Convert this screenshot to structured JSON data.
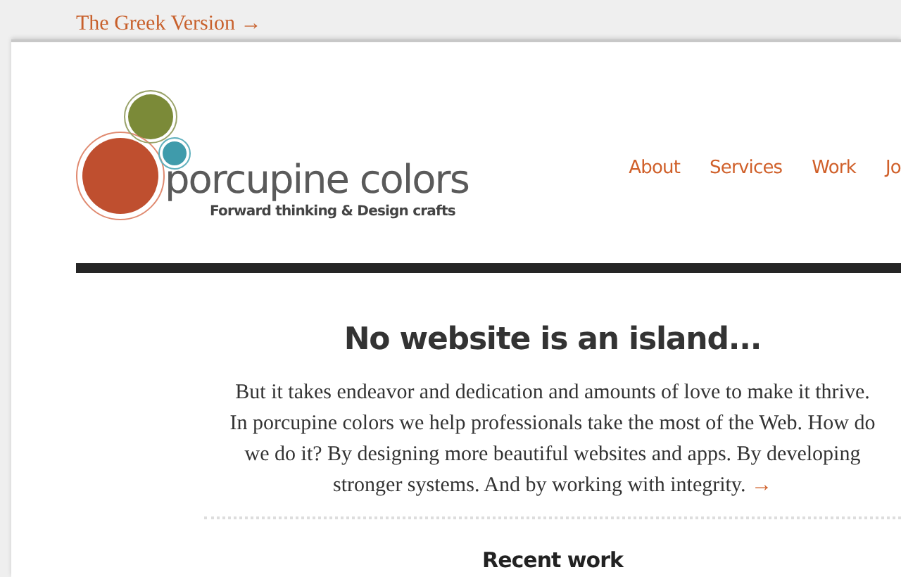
{
  "top_link": "The Greek Version →",
  "logo": {
    "name": "porcupine colors",
    "tagline": "Forward thinking & Design crafts"
  },
  "nav": [
    {
      "label": "About"
    },
    {
      "label": "Services"
    },
    {
      "label": "Work"
    },
    {
      "label": "Jo"
    }
  ],
  "intro": {
    "title": "No website is an island...",
    "text": "But it takes endeavor and dedication and amounts of love to make it thrive. In porcupine colors we help professionals take the most of the Web.  How do we do it? By designing more beautiful websites and apps.  By developing stronger systems.  And by working with integrity.",
    "more_link": "→"
  },
  "section_title": "Recent work"
}
